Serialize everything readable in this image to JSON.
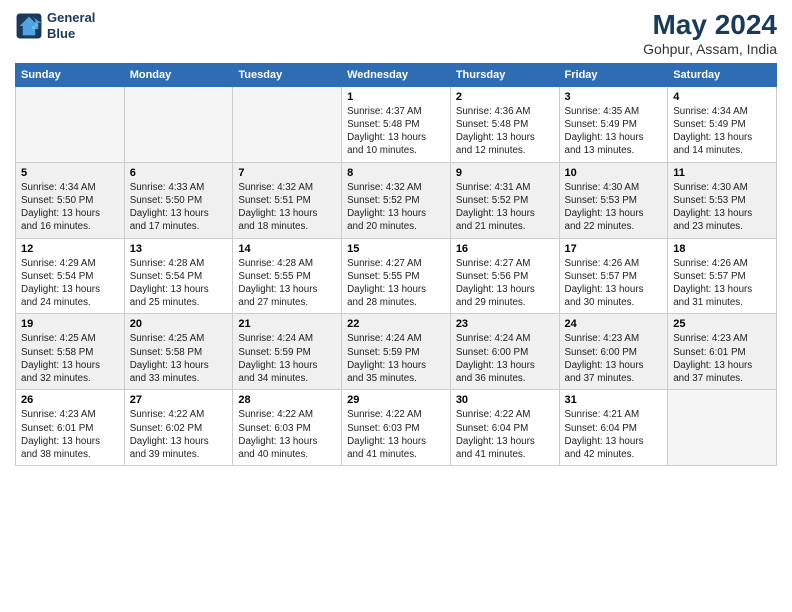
{
  "logo": {
    "line1": "General",
    "line2": "Blue"
  },
  "title": "May 2024",
  "subtitle": "Gohpur, Assam, India",
  "days_header": [
    "Sunday",
    "Monday",
    "Tuesday",
    "Wednesday",
    "Thursday",
    "Friday",
    "Saturday"
  ],
  "weeks": [
    [
      {
        "day": "",
        "info": ""
      },
      {
        "day": "",
        "info": ""
      },
      {
        "day": "",
        "info": ""
      },
      {
        "day": "1",
        "info": "Sunrise: 4:37 AM\nSunset: 5:48 PM\nDaylight: 13 hours\nand 10 minutes."
      },
      {
        "day": "2",
        "info": "Sunrise: 4:36 AM\nSunset: 5:48 PM\nDaylight: 13 hours\nand 12 minutes."
      },
      {
        "day": "3",
        "info": "Sunrise: 4:35 AM\nSunset: 5:49 PM\nDaylight: 13 hours\nand 13 minutes."
      },
      {
        "day": "4",
        "info": "Sunrise: 4:34 AM\nSunset: 5:49 PM\nDaylight: 13 hours\nand 14 minutes."
      }
    ],
    [
      {
        "day": "5",
        "info": "Sunrise: 4:34 AM\nSunset: 5:50 PM\nDaylight: 13 hours\nand 16 minutes."
      },
      {
        "day": "6",
        "info": "Sunrise: 4:33 AM\nSunset: 5:50 PM\nDaylight: 13 hours\nand 17 minutes."
      },
      {
        "day": "7",
        "info": "Sunrise: 4:32 AM\nSunset: 5:51 PM\nDaylight: 13 hours\nand 18 minutes."
      },
      {
        "day": "8",
        "info": "Sunrise: 4:32 AM\nSunset: 5:52 PM\nDaylight: 13 hours\nand 20 minutes."
      },
      {
        "day": "9",
        "info": "Sunrise: 4:31 AM\nSunset: 5:52 PM\nDaylight: 13 hours\nand 21 minutes."
      },
      {
        "day": "10",
        "info": "Sunrise: 4:30 AM\nSunset: 5:53 PM\nDaylight: 13 hours\nand 22 minutes."
      },
      {
        "day": "11",
        "info": "Sunrise: 4:30 AM\nSunset: 5:53 PM\nDaylight: 13 hours\nand 23 minutes."
      }
    ],
    [
      {
        "day": "12",
        "info": "Sunrise: 4:29 AM\nSunset: 5:54 PM\nDaylight: 13 hours\nand 24 minutes."
      },
      {
        "day": "13",
        "info": "Sunrise: 4:28 AM\nSunset: 5:54 PM\nDaylight: 13 hours\nand 25 minutes."
      },
      {
        "day": "14",
        "info": "Sunrise: 4:28 AM\nSunset: 5:55 PM\nDaylight: 13 hours\nand 27 minutes."
      },
      {
        "day": "15",
        "info": "Sunrise: 4:27 AM\nSunset: 5:55 PM\nDaylight: 13 hours\nand 28 minutes."
      },
      {
        "day": "16",
        "info": "Sunrise: 4:27 AM\nSunset: 5:56 PM\nDaylight: 13 hours\nand 29 minutes."
      },
      {
        "day": "17",
        "info": "Sunrise: 4:26 AM\nSunset: 5:57 PM\nDaylight: 13 hours\nand 30 minutes."
      },
      {
        "day": "18",
        "info": "Sunrise: 4:26 AM\nSunset: 5:57 PM\nDaylight: 13 hours\nand 31 minutes."
      }
    ],
    [
      {
        "day": "19",
        "info": "Sunrise: 4:25 AM\nSunset: 5:58 PM\nDaylight: 13 hours\nand 32 minutes."
      },
      {
        "day": "20",
        "info": "Sunrise: 4:25 AM\nSunset: 5:58 PM\nDaylight: 13 hours\nand 33 minutes."
      },
      {
        "day": "21",
        "info": "Sunrise: 4:24 AM\nSunset: 5:59 PM\nDaylight: 13 hours\nand 34 minutes."
      },
      {
        "day": "22",
        "info": "Sunrise: 4:24 AM\nSunset: 5:59 PM\nDaylight: 13 hours\nand 35 minutes."
      },
      {
        "day": "23",
        "info": "Sunrise: 4:24 AM\nSunset: 6:00 PM\nDaylight: 13 hours\nand 36 minutes."
      },
      {
        "day": "24",
        "info": "Sunrise: 4:23 AM\nSunset: 6:00 PM\nDaylight: 13 hours\nand 37 minutes."
      },
      {
        "day": "25",
        "info": "Sunrise: 4:23 AM\nSunset: 6:01 PM\nDaylight: 13 hours\nand 37 minutes."
      }
    ],
    [
      {
        "day": "26",
        "info": "Sunrise: 4:23 AM\nSunset: 6:01 PM\nDaylight: 13 hours\nand 38 minutes."
      },
      {
        "day": "27",
        "info": "Sunrise: 4:22 AM\nSunset: 6:02 PM\nDaylight: 13 hours\nand 39 minutes."
      },
      {
        "day": "28",
        "info": "Sunrise: 4:22 AM\nSunset: 6:03 PM\nDaylight: 13 hours\nand 40 minutes."
      },
      {
        "day": "29",
        "info": "Sunrise: 4:22 AM\nSunset: 6:03 PM\nDaylight: 13 hours\nand 41 minutes."
      },
      {
        "day": "30",
        "info": "Sunrise: 4:22 AM\nSunset: 6:04 PM\nDaylight: 13 hours\nand 41 minutes."
      },
      {
        "day": "31",
        "info": "Sunrise: 4:21 AM\nSunset: 6:04 PM\nDaylight: 13 hours\nand 42 minutes."
      },
      {
        "day": "",
        "info": ""
      }
    ]
  ],
  "colors": {
    "header_bg": "#2e6db4",
    "header_text": "#ffffff",
    "title_color": "#1a3a5c",
    "row_odd": "#f0f0f0",
    "row_even": "#ffffff"
  }
}
